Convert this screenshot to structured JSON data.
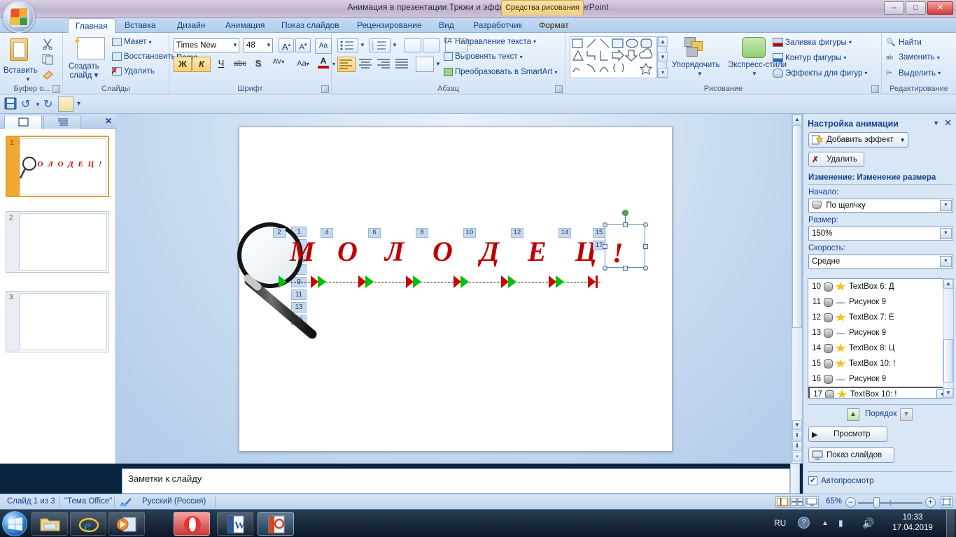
{
  "titlebar": {
    "title": "Анимация в презентации Трюки и эффекты - Microsoft PowerPoint",
    "contextual_tab_group": "Средства рисования",
    "minimize": "–",
    "maximize": "□",
    "close": "✕"
  },
  "tabs": [
    {
      "label": "Главная",
      "active": true
    },
    {
      "label": "Вставка",
      "active": false
    },
    {
      "label": "Дизайн",
      "active": false
    },
    {
      "label": "Анимация",
      "active": false
    },
    {
      "label": "Показ слайдов",
      "active": false
    },
    {
      "label": "Рецензирование",
      "active": false
    },
    {
      "label": "Вид",
      "active": false
    },
    {
      "label": "Разработчик",
      "active": false
    },
    {
      "label": "Формат",
      "active": false
    }
  ],
  "ribbon": {
    "groups": [
      {
        "label": "Буфер о..."
      },
      {
        "label": "Слайды"
      },
      {
        "label": "Шрифт"
      },
      {
        "label": "Абзац"
      },
      {
        "label": "Рисование"
      },
      {
        "label": "Редактирование"
      }
    ],
    "clipboard": {
      "paste": "Вставить",
      "cut_icon": "scissors-icon",
      "copy_icon": "copy-icon",
      "format_painter_icon": "format-painter-icon"
    },
    "slides": {
      "new_slide": "Создать\nслайд",
      "layout": "Макет",
      "reset": "Восстановить",
      "delete": "Удалить"
    },
    "font": {
      "font_name": "Times New Roma",
      "font_size": "48",
      "bold": "Ж",
      "italic": "К",
      "underline": "Ч",
      "strike": "abc",
      "shadow": "S",
      "spacing": "AV",
      "change_case": "Aa",
      "font_color": "A",
      "grow": "A",
      "shrink": "A",
      "clear_format": "Aa"
    },
    "paragraph": {
      "text_direction": "Направление текста",
      "align_text": "Выровнять текст",
      "convert_smartart": "Преобразовать в SmartArt"
    },
    "drawing": {
      "arrange": "Упорядочить",
      "quick_styles": "Экспресс-стили",
      "shape_fill": "Заливка фигуры",
      "shape_outline": "Контур фигуры",
      "shape_effects": "Эффекты для фигур"
    },
    "editing": {
      "find": "Найти",
      "replace": "Заменить",
      "select": "Выделить"
    }
  },
  "quick_access": {
    "save_icon": "save-icon",
    "undo_icon": "undo-icon",
    "redo_icon": "redo-icon",
    "custom_icon": "customize-icon",
    "more_icon": "more-icon"
  },
  "thumbnail_pane": {
    "tab_slides_icon": "slides-tab-icon",
    "tab_outline_icon": "outline-tab-icon",
    "close": "✕",
    "slides": [
      {
        "number": "1",
        "selected": true,
        "text": "М О Л О Д Е Ц !"
      },
      {
        "number": "2",
        "selected": false,
        "text": ""
      },
      {
        "number": "3",
        "selected": false,
        "text": ""
      }
    ]
  },
  "slide": {
    "left_numbers": [
      "1",
      "3",
      "5",
      "7",
      "9",
      "11",
      "13",
      "16"
    ],
    "letters": [
      {
        "char": "М",
        "tag": "2"
      },
      {
        "char": "О",
        "tag": "4"
      },
      {
        "char": "Л",
        "tag": "6"
      },
      {
        "char": "О",
        "tag": "8"
      },
      {
        "char": "Д",
        "tag": "10"
      },
      {
        "char": "Е",
        "tag": "12"
      },
      {
        "char": "Е",
        "tag": "14"
      },
      {
        "char": "Ц",
        "tag": "15"
      },
      {
        "char": "!",
        "tag": "17"
      }
    ],
    "magnifier_icon": "magnifier-icon",
    "text_color": "#c00000"
  },
  "notes": {
    "placeholder": "Заметки к слайду"
  },
  "animation_pane": {
    "title": "Настройка анимации",
    "close": "✕",
    "caret": "▼",
    "add_effect": "Добавить эффект",
    "add_effect_icon": "add-effect-icon",
    "remove": "Удалить",
    "remove_icon": "remove-effect-icon",
    "modify_heading": "Изменение: Изменение размера",
    "start_label": "Начало:",
    "start_value": "По щелчку",
    "size_label": "Размер:",
    "size_value": "150%",
    "speed_label": "Скорость:",
    "speed_value": "Средне",
    "list": [
      {
        "index": "10",
        "icon": "star-icon",
        "label": "TextBox 6: Д",
        "selected": false
      },
      {
        "index": "11",
        "icon": "line-icon",
        "label": "Рисунок 9",
        "selected": false
      },
      {
        "index": "12",
        "icon": "star-icon",
        "label": "TextBox 7: Е",
        "selected": false
      },
      {
        "index": "13",
        "icon": "line-icon",
        "label": "Рисунок 9",
        "selected": false
      },
      {
        "index": "14",
        "icon": "star-icon",
        "label": "TextBox 8: Ц",
        "selected": false
      },
      {
        "index": "15",
        "icon": "star-icon",
        "label": "TextBox 10: !",
        "selected": false
      },
      {
        "index": "16",
        "icon": "line-icon",
        "label": "Рисунок 9",
        "selected": false
      },
      {
        "index": "17",
        "icon": "star-icon",
        "label": "TextBox 10: !",
        "selected": true
      }
    ],
    "order_label": "Порядок",
    "order_up_icon": "arrow-up-icon",
    "order_down_icon": "arrow-down-icon",
    "preview": "Просмотр",
    "preview_icon": "play-icon",
    "slideshow": "Показ слайдов",
    "slideshow_icon": "slideshow-icon",
    "autopreview": "Автопросмотр",
    "autopreview_checked": true
  },
  "statusbar": {
    "slide_count": "Слайд 1 из 3",
    "theme": "\"Тема Office\"",
    "spellcheck_icon": "spellcheck-icon",
    "language": "Русский (Россия)",
    "view_normal_icon": "view-normal-icon",
    "view_sorter_icon": "view-sorter-icon",
    "view_show_icon": "view-slideshow-icon",
    "zoom": "65%",
    "zoom_out": "–",
    "zoom_in": "+",
    "fit_icon": "fit-to-window-icon"
  },
  "taskbar": {
    "start_icon": "windows-start-icon",
    "items": [
      {
        "icon": "explorer-icon",
        "active": false
      },
      {
        "icon": "internet-explorer-icon",
        "active": false
      },
      {
        "icon": "media-player-icon",
        "active": false
      },
      {
        "icon": "opera-icon",
        "active": true
      },
      {
        "icon": "word-icon",
        "active": false
      },
      {
        "icon": "powerpoint-icon",
        "active": true
      }
    ],
    "lang": "RU",
    "help_icon": "help-icon",
    "tray_up_icon": "tray-expand-icon",
    "network_icon": "network-icon",
    "volume_icon": "volume-icon",
    "time": "10:33",
    "date": "17.04.2019"
  }
}
